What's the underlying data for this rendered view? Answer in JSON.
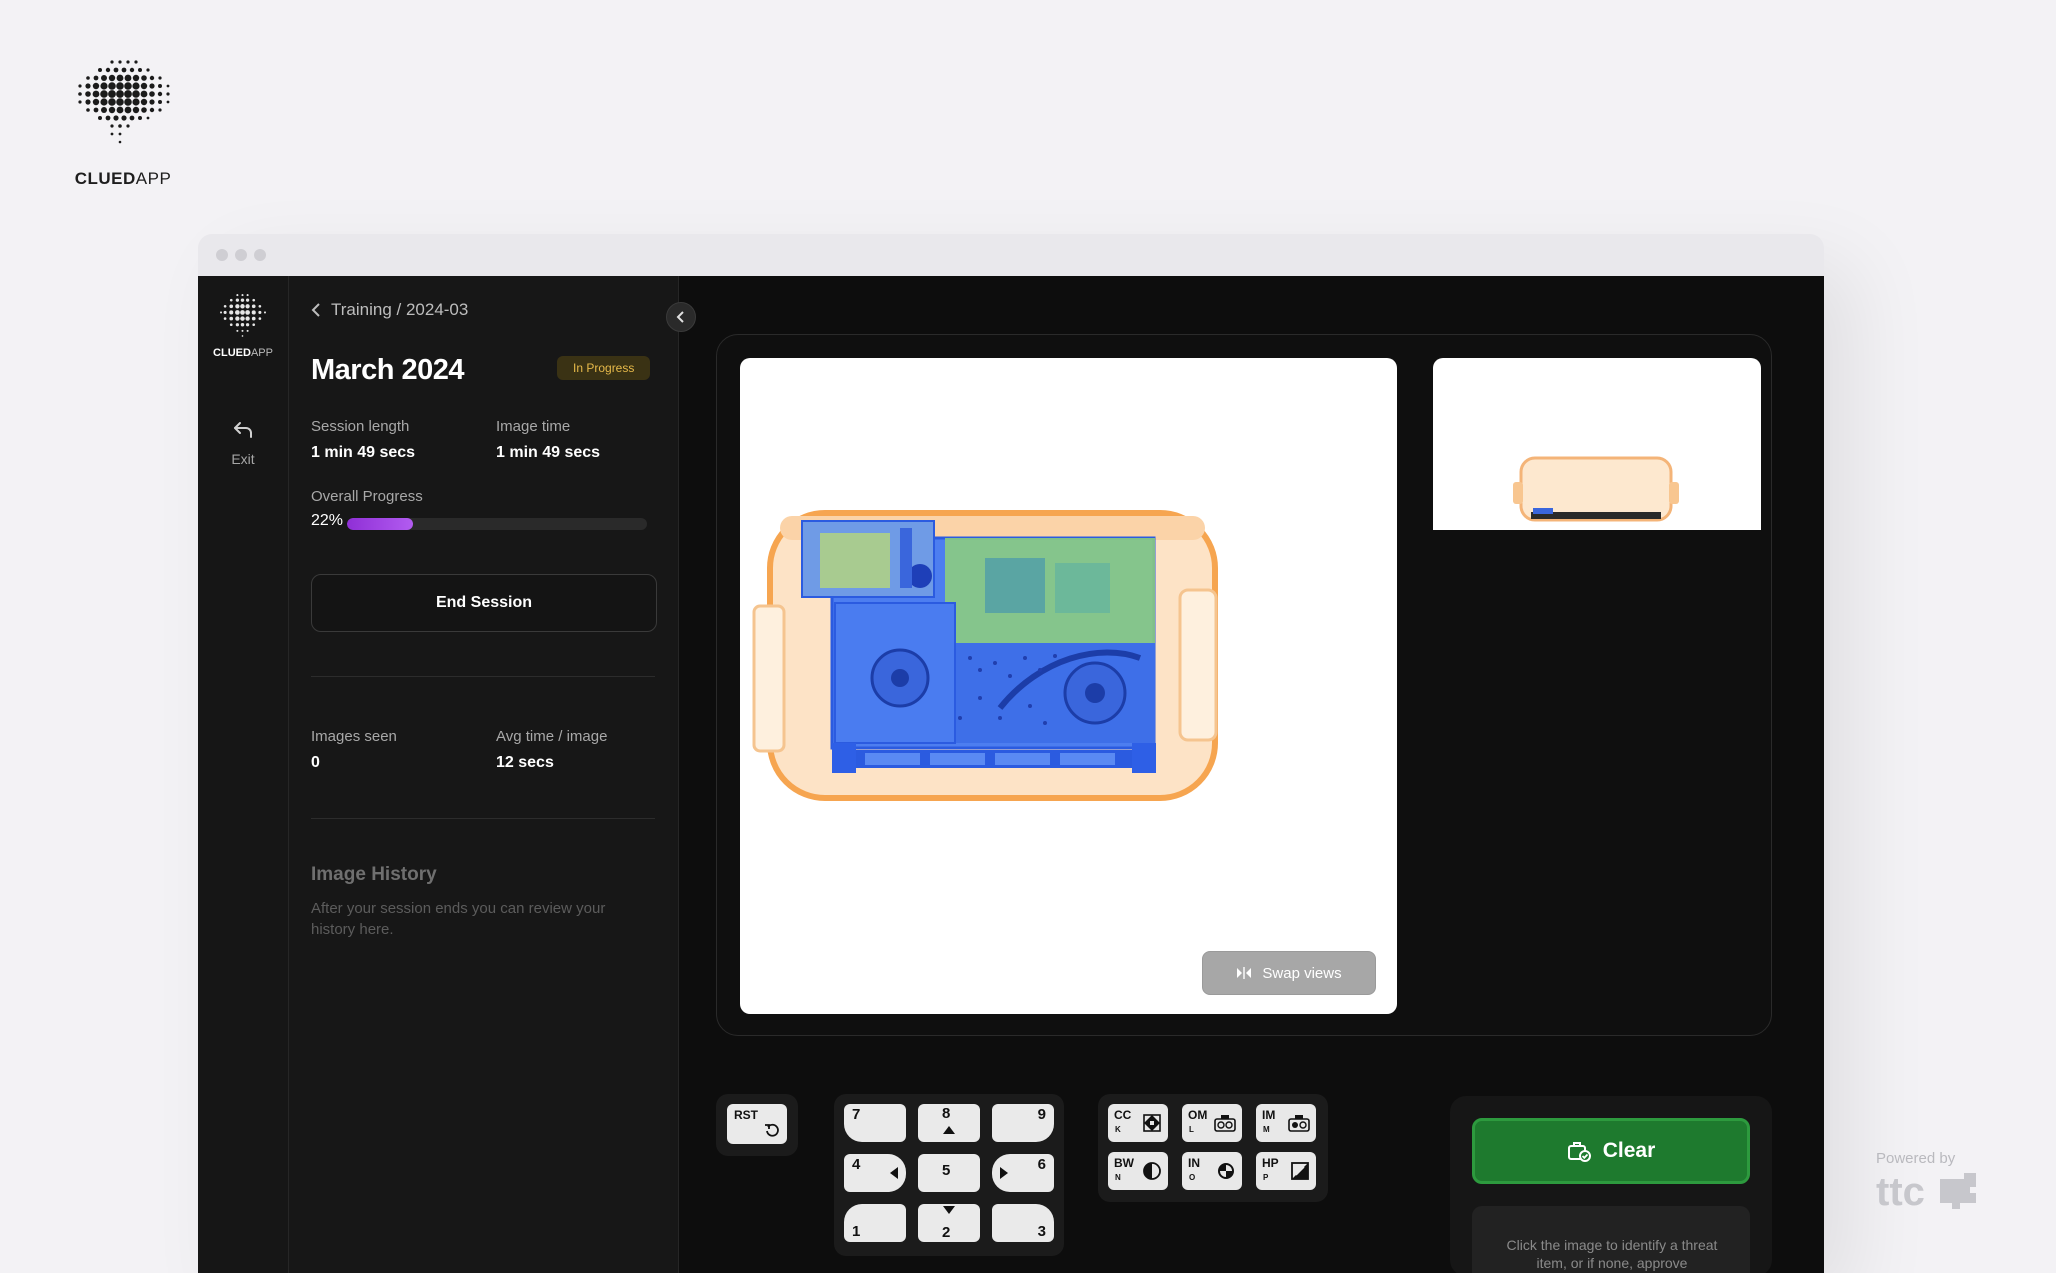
{
  "brand": {
    "name_bold": "CLUED",
    "name_light": "APP"
  },
  "rail": {
    "logo_bold": "CLUED",
    "logo_light": "APP",
    "exit_label": "Exit"
  },
  "panel": {
    "breadcrumb": "Training / 2024-03",
    "title": "March 2024",
    "status_badge": "In Progress",
    "session_length_label": "Session length",
    "session_length_value": "1 min 49 secs",
    "image_time_label": "Image time",
    "image_time_value": "1 min 49 secs",
    "overall_progress_label": "Overall Progress",
    "overall_progress_text": "22%",
    "overall_progress_value": 0.22,
    "end_session_label": "End Session",
    "images_seen_label": "Images seen",
    "images_seen_value": "0",
    "avg_time_label": "Avg time / image",
    "avg_time_value": "12 secs",
    "history_title": "Image History",
    "history_text": "After your session ends you can review your history here."
  },
  "viewer": {
    "swap_label": "Swap views"
  },
  "keypad": {
    "reset_label": "RST",
    "digits": [
      "7",
      "8",
      "9",
      "4",
      "5",
      "6",
      "1",
      "2",
      "3"
    ]
  },
  "function_keys": [
    {
      "code": "CC",
      "sub": "K",
      "icon": "diamond-grid-icon"
    },
    {
      "code": "OM",
      "sub": "L",
      "icon": "organic-icon"
    },
    {
      "code": "IM",
      "sub": "M",
      "icon": "inorganic-icon"
    },
    {
      "code": "BW",
      "sub": "N",
      "icon": "half-circle-icon"
    },
    {
      "code": "IN",
      "sub": "O",
      "icon": "invert-icon"
    },
    {
      "code": "HP",
      "sub": "P",
      "icon": "high-penetration-icon"
    }
  ],
  "clear": {
    "label": "Clear",
    "hint": "Click the image to identify a threat item, or if none, approve"
  },
  "powered_by": {
    "label": "Powered by",
    "logo": "ttc"
  },
  "colors": {
    "accent_purple": "#9b3be0",
    "clear_green": "#1e7a2e",
    "badge_amber": "#e6b94a"
  }
}
